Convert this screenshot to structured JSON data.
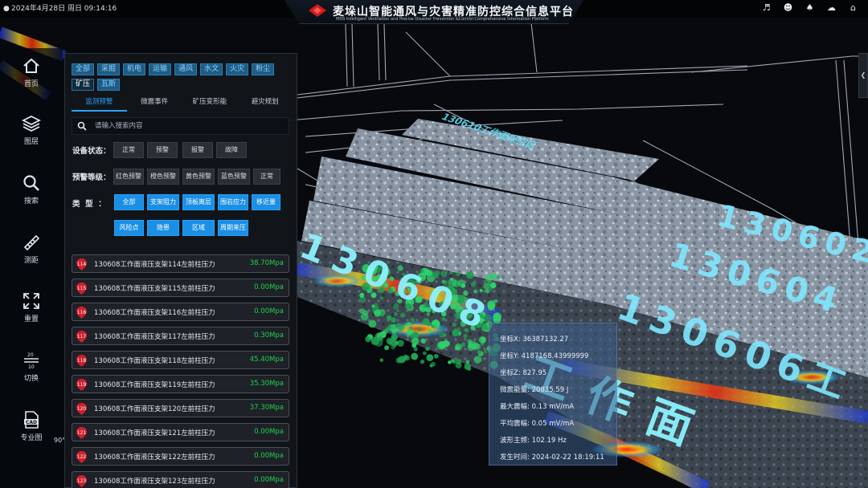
{
  "app": {
    "datetime": "2024年4月28日 周日 09:14:16",
    "title": "麦垛山智能通风与灾害精准防控综合信息平台",
    "subtitle": "MDS Intelligent Ventilation and Precise Disaster Prevention &Control Comprehensive Information Platform"
  },
  "top_icons": [
    "speaker-icon",
    "user-icon",
    "bell-icon",
    "cloud-icon",
    "home-icon"
  ],
  "sidebar": {
    "items": [
      {
        "label": "首页",
        "icon": "home-icon"
      },
      {
        "label": "图层",
        "icon": "layers-icon"
      },
      {
        "label": "搜索",
        "icon": "search-icon"
      },
      {
        "label": "测距",
        "icon": "ruler-icon"
      },
      {
        "label": "重置",
        "icon": "expand-icon"
      },
      {
        "label": "切换",
        "icon": "switch-icon"
      },
      {
        "label": "专业图",
        "icon": "cad-icon"
      }
    ],
    "switch_nums": [
      "20",
      "10"
    ],
    "cad_text": "CAD"
  },
  "filters": {
    "tags": [
      "全部",
      "采掘",
      "机电",
      "运输",
      "通风",
      "水文",
      "火灾",
      "粉尘",
      "矿压",
      "瓦斯"
    ],
    "selected": "矿压"
  },
  "subtabs": {
    "items": [
      "监测预警",
      "微震事件",
      "矿压变形能",
      "避灾规划"
    ],
    "selected": "监测预警"
  },
  "search": {
    "placeholder": "请输入搜索内容"
  },
  "device_status": {
    "label": "设备状态：",
    "options": [
      "正常",
      "预警",
      "报警",
      "故障"
    ]
  },
  "warning_level": {
    "label": "预警等级：",
    "options": [
      "红色预警",
      "橙色预警",
      "黄色预警",
      "蓝色预警",
      "正常"
    ]
  },
  "type_filter": {
    "label": "类  型  ：",
    "options": [
      "全部",
      "支架阻力",
      "顶板离层",
      "围岩应力",
      "移近量",
      "风险点",
      "隐患",
      "区域",
      "周期来压"
    ]
  },
  "list": [
    {
      "num": "114",
      "name": "130608工作面液压支架114左前柱压力",
      "value": "38.70Mpa"
    },
    {
      "num": "115",
      "name": "130608工作面液压支架115左前柱压力",
      "value": "0.00Mpa"
    },
    {
      "num": "116",
      "name": "130608工作面液压支架116左前柱压力",
      "value": "0.00Mpa"
    },
    {
      "num": "117",
      "name": "130608工作面液压支架117左前柱压力",
      "value": "0.30Mpa"
    },
    {
      "num": "118",
      "name": "130608工作面液压支架118左前柱压力",
      "value": "45.40Mpa"
    },
    {
      "num": "119",
      "name": "130608工作面液压支架119左前柱压力",
      "value": "35.30Mpa"
    },
    {
      "num": "120",
      "name": "130608工作面液压支架120左前柱压力",
      "value": "37.30Mpa"
    },
    {
      "num": "121",
      "name": "130608工作面液压支架121左前柱压力",
      "value": "0.00Mpa"
    },
    {
      "num": "122",
      "name": "130608工作面液压支架122左前柱压力",
      "value": "0.00Mpa"
    },
    {
      "num": "123",
      "name": "130608工作面液压支架123左前柱压力",
      "value": "0.00Mpa"
    }
  ],
  "popup": {
    "lines": [
      "坐标X: 36387132.27",
      "坐标Y: 4187168.43999999",
      "坐标Z: 827.95",
      "微震能量: 20835.59 J",
      "最大震幅: 0.13 mV/mA",
      "平均震幅: 0.05 mV/mA",
      "波形主频: 102.19 Hz",
      "发生时间: 2024-02-22 18:19:11"
    ]
  },
  "scene": {
    "labels": [
      "130610工作面采空区",
      "130602",
      "130604",
      "130606工",
      "130608",
      "工作面"
    ]
  },
  "compass_label": "90°",
  "handle_icon": "chevron-left-icon"
}
